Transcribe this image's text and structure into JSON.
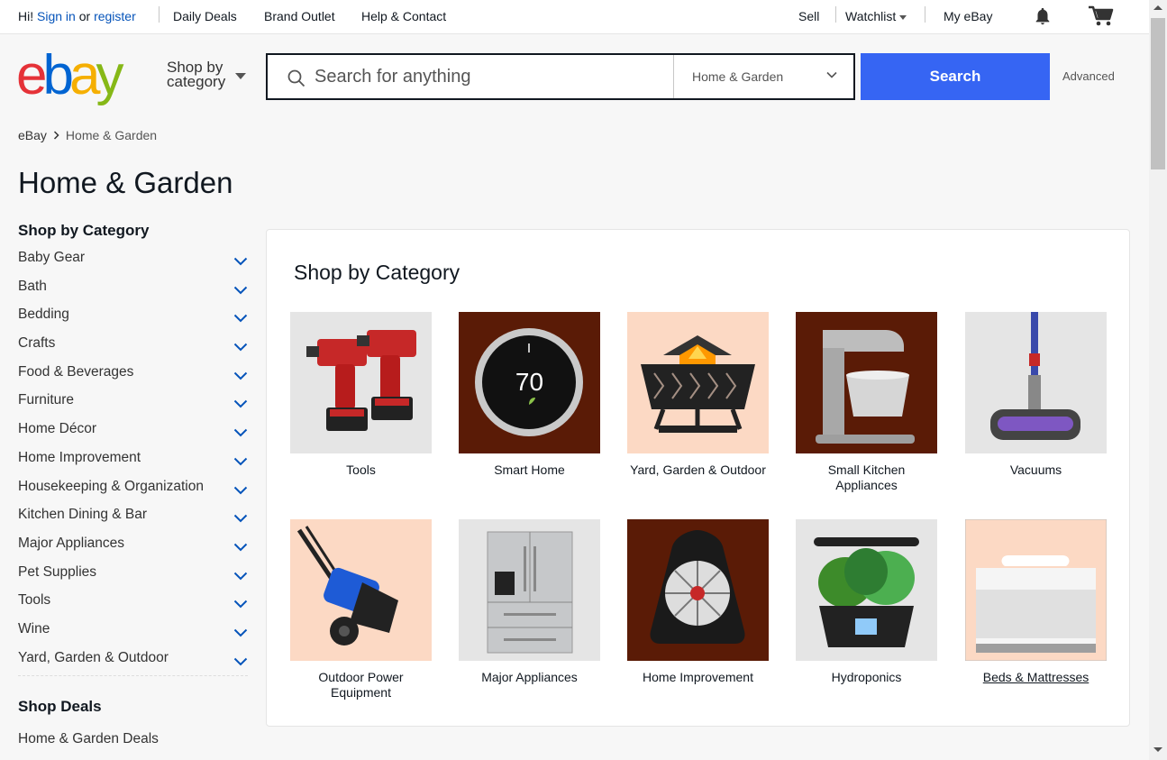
{
  "topbar": {
    "greeting": "Hi!",
    "sign_in": "Sign in",
    "or": "or",
    "register": "register",
    "daily_deals": "Daily Deals",
    "brand_outlet": "Brand Outlet",
    "help_contact": "Help & Contact",
    "sell": "Sell",
    "watchlist": "Watchlist",
    "my_ebay": "My eBay",
    "icons": [
      "bell-icon",
      "cart-icon"
    ]
  },
  "header": {
    "logo": "ebay",
    "shop_by_line1": "Shop by",
    "shop_by_line2": "category",
    "search_placeholder": "Search for anything",
    "category_selected": "Home & Garden",
    "search_button": "Search",
    "advanced": "Advanced"
  },
  "breadcrumb": [
    "eBay",
    "Home & Garden"
  ],
  "page_title": "Home & Garden",
  "sidebar": {
    "heading": "Shop by Category",
    "items": [
      "Baby Gear",
      "Bath",
      "Bedding",
      "Crafts",
      "Food & Beverages",
      "Furniture",
      "Home Décor",
      "Home Improvement",
      "Housekeeping & Organization",
      "Kitchen Dining & Bar",
      "Major Appliances",
      "Pet Supplies",
      "Tools",
      "Wine",
      "Yard, Garden & Outdoor"
    ],
    "deals_heading": "Shop Deals",
    "deals_items": [
      "Home & Garden Deals"
    ]
  },
  "panel": {
    "title": "Shop by Category",
    "tiles": [
      {
        "label": "Tools",
        "bg": "#e5e5e5"
      },
      {
        "label": "Smart Home",
        "bg": "#5a1b06",
        "display": "70"
      },
      {
        "label": "Yard, Garden & Outdoor",
        "bg": "#fcd9c4"
      },
      {
        "label": "Small Kitchen Appliances",
        "bg": "#5a1b06"
      },
      {
        "label": "Vacuums",
        "bg": "#e5e5e5"
      },
      {
        "label": "Outdoor Power Equipment",
        "bg": "#fcd9c4"
      },
      {
        "label": "Major Appliances",
        "bg": "#e5e5e5"
      },
      {
        "label": "Home Improvement",
        "bg": "#5a1b06"
      },
      {
        "label": "Hydroponics",
        "bg": "#e5e5e5"
      },
      {
        "label": "Beds & Mattresses",
        "bg": "#fcd9c4"
      }
    ]
  },
  "colors": {
    "link": "#0654ba",
    "search_button": "#3665f3",
    "tile_dark": "#5a1b06",
    "tile_peach": "#fcd9c4",
    "tile_grey": "#e5e5e5"
  }
}
